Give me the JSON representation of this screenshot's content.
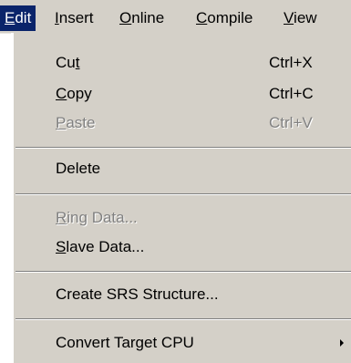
{
  "menubar": {
    "items": [
      {
        "label": "Edit",
        "mnemonic_index": 0
      },
      {
        "label": "Insert",
        "mnemonic_index": 0
      },
      {
        "label": "Online",
        "mnemonic_index": 0
      },
      {
        "label": "Compile",
        "mnemonic_index": 0
      },
      {
        "label": "View",
        "mnemonic_index": 0
      }
    ]
  },
  "edit_menu": {
    "items": [
      {
        "label": "Cut",
        "shortcut": "Ctrl+X",
        "enabled": true
      },
      {
        "label": "Copy",
        "shortcut": "Ctrl+C",
        "enabled": true
      },
      {
        "label": "Paste",
        "shortcut": "Ctrl+V",
        "enabled": false
      },
      {
        "label": "Delete",
        "enabled": true
      },
      {
        "label": "Ring Data...",
        "enabled": false
      },
      {
        "label": "Slave Data...",
        "enabled": true
      },
      {
        "label": "Create SRS Structure...",
        "enabled": true
      },
      {
        "label": "Convert Target CPU",
        "enabled": true,
        "submenu": true
      }
    ]
  },
  "colors": {
    "menu_background": "#d4d0c8",
    "highlight": "#0a246a",
    "disabled_text": "#808080"
  }
}
